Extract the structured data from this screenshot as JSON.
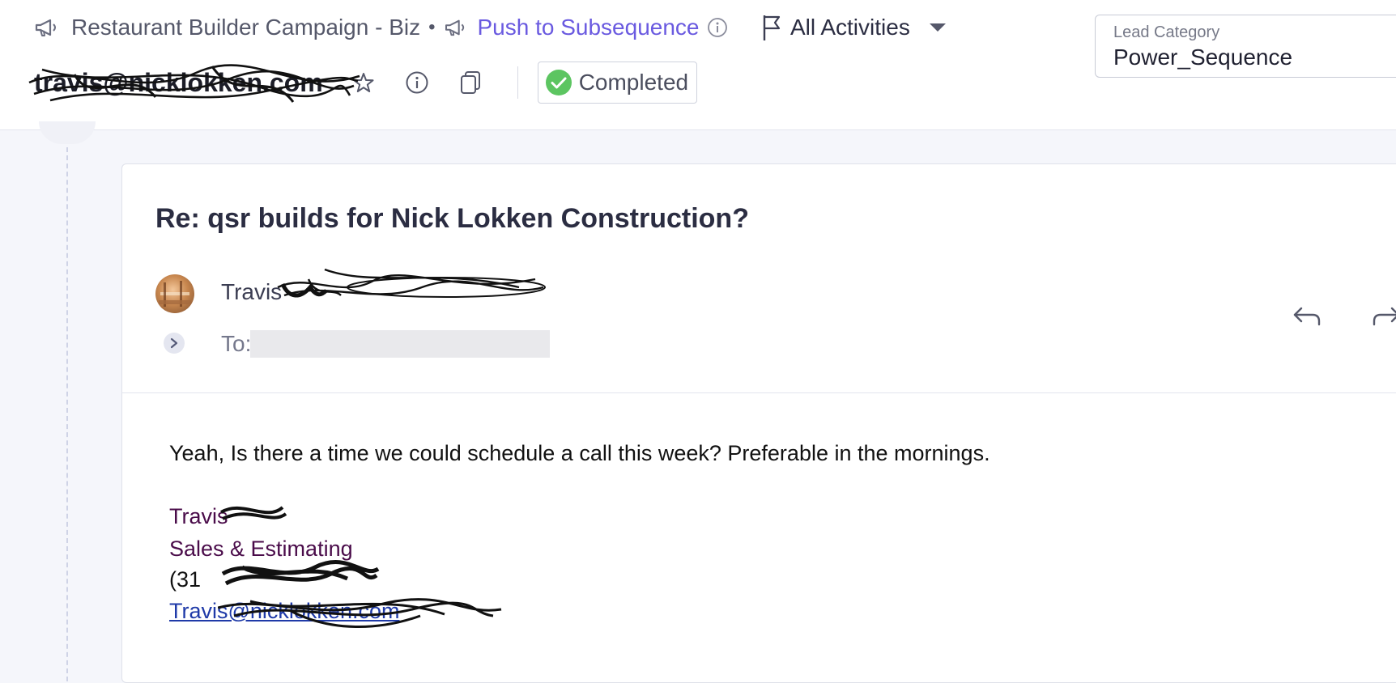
{
  "header": {
    "campaign_name": "Restaurant Builder Campaign - Biz",
    "separator": "•",
    "subsequence_link": "Push to Subsequence",
    "lead_email": "travis@nicklokken.com",
    "status": "Completed",
    "activities_filter": "All Activities",
    "lead_category": {
      "label": "Lead Category",
      "value": "Power_Sequence"
    }
  },
  "email": {
    "subject": "Re: qsr builds for Nick Lokken Construction?",
    "sender_name": "Travis",
    "to_label": "To:",
    "body": "Yeah, Is there a time we could schedule a call this week? Preferable in the mornings.",
    "signature": {
      "name": "Travis",
      "title": "Sales & Estimating",
      "phone": "(31",
      "email": "Travis@nicklokken.com"
    }
  },
  "colors": {
    "accent": "#6a5ae0",
    "success": "#5cc561",
    "signature": "#4a0c4a",
    "link": "#1f3aa8"
  },
  "icons": [
    "megaphone-icon",
    "info-icon",
    "flag-icon",
    "caret-down-icon",
    "star-icon",
    "copy-icon",
    "check-circle-icon",
    "chevron-right-icon",
    "reply-icon",
    "forward-icon"
  ]
}
